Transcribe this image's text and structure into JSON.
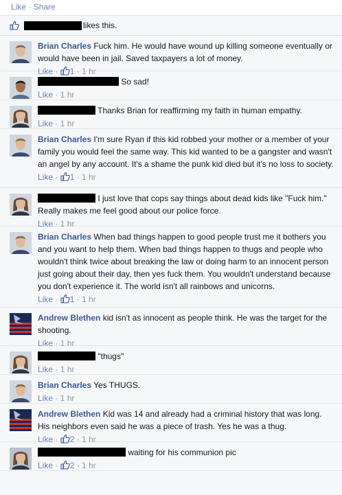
{
  "topbar": {
    "like": "Like",
    "sep": "·",
    "share": "Share"
  },
  "likes": {
    "suffix": "likes this."
  },
  "comments": [
    {
      "author": "Brian Charles",
      "text": "Fuck him. He would have wound up killing someone eventually or would have been in jail. Saved taxpayers a lot of money.",
      "like": "Like",
      "likes": "1",
      "time": "1 hr",
      "avatar": "man"
    },
    {
      "author": "",
      "text": "So sad!",
      "like": "Like",
      "time": "1 hr",
      "avatar": "man2"
    },
    {
      "author": "",
      "text": "Thanks Brian for reaffirming my faith in human empathy.",
      "like": "Like",
      "time": "1 hr",
      "avatar": "woman"
    },
    {
      "author": "Brian Charles",
      "text": "I'm sure Ryan if this kid robbed your mother or a member of your family you would feel the same way. This kid wanted to be a gangster and wasn't an angel by any account. It's a shame the punk kid died but it's no loss to society.",
      "like": "Like",
      "likes": "1",
      "time": "1 hr",
      "avatar": "man"
    },
    {
      "author": "",
      "text": "I just love that cops say things about dead kids like \"Fuck him.\" Really makes me feel good about our police force.",
      "like": "Like",
      "time": "1 hr",
      "avatar": "woman"
    },
    {
      "author": "Brian Charles",
      "text": "When bad things happen to good people trust me it bothers you and you want to help them. When bad things happen to thugs and people who wouldn't think twice about breaking the law or doing harm to an innocent person just going about their day, then yes fuck them. You wouldn't understand because you don't experience it. The world isn't all rainbows and unicorns.",
      "like": "Like",
      "likes": "1",
      "time": "1 hr",
      "avatar": "man"
    },
    {
      "author": "Andrew Blethen",
      "text": "kid isn't as innocent as people think. He was the target for the shooting.",
      "like": "Like",
      "time": "1 hr",
      "avatar": "flag"
    },
    {
      "author": "",
      "text": "\"thugs\"",
      "like": "Like",
      "time": "1 hr",
      "avatar": "woman"
    },
    {
      "author": "Brian Charles",
      "text": "Yes THUGS.",
      "like": "Like",
      "time": "1 hr",
      "avatar": "man"
    },
    {
      "author": "Andrew Blethen",
      "text": "Kid was 14 and already had a criminal history that was long. His neighbors even said he was a piece of trash. Yes he was a thug.",
      "like": "Like",
      "likes": "2",
      "time": "1 hr",
      "avatar": "flag"
    },
    {
      "author": "",
      "text": "waiting for his communion pic",
      "like": "Like",
      "likes": "2",
      "time": "1 hr",
      "avatar": "woman2"
    }
  ]
}
